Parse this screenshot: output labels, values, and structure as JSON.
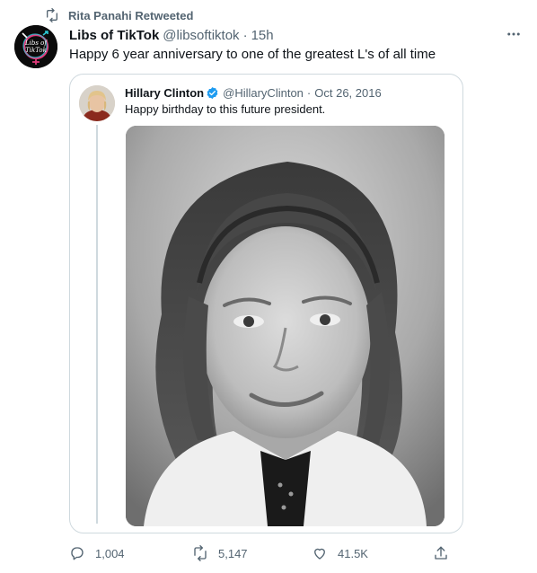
{
  "retweet_banner": {
    "text": "Rita Panahi Retweeted"
  },
  "tweet": {
    "author_name": "Libs of TikTok",
    "author_handle": "@libsoftiktok",
    "separator": "·",
    "time": "15h",
    "avatar_text_line1": "Libs of",
    "avatar_text_line2": "TikTok",
    "text": "Happy 6 year anniversary to one of the greatest L's of all time"
  },
  "quoted_tweet": {
    "author_name": "Hillary Clinton",
    "author_handle": "@HillaryClinton",
    "separator": "·",
    "date": "Oct 26, 2016",
    "text": "Happy birthday to this future president."
  },
  "actions": {
    "replies": "1,004",
    "retweets": "5,147",
    "likes": "41.5K"
  },
  "icons": {
    "retweet_banner": "retweet-icon",
    "more": "more-icon",
    "verified": "verified-badge-icon",
    "reply": "reply-icon",
    "retweet": "retweet-icon",
    "like": "heart-icon",
    "share": "share-icon"
  },
  "colors": {
    "text": "#0f1419",
    "secondary": "#536471",
    "verified": "#1d9bf0",
    "border": "#cfd9de"
  }
}
